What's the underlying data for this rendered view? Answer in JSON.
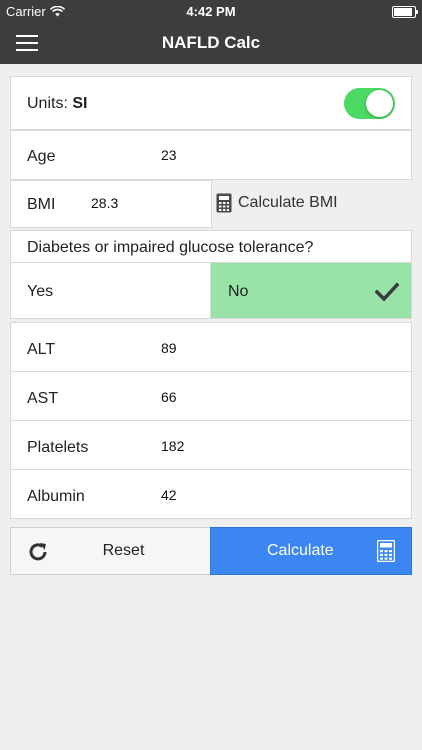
{
  "status_bar": {
    "carrier": "Carrier",
    "time": "4:42 PM"
  },
  "nav": {
    "title": "NAFLD Calc"
  },
  "units": {
    "label": "Units:",
    "value": "SI",
    "toggle_on": true
  },
  "age": {
    "label": "Age",
    "value": "23"
  },
  "bmi": {
    "label": "BMI",
    "value": "28.3",
    "calculate_label": "Calculate BMI"
  },
  "diabetes": {
    "question": "Diabetes or impaired glucose tolerance?",
    "yes_label": "Yes",
    "no_label": "No",
    "selected": "No"
  },
  "labs": [
    {
      "label": "ALT",
      "value": "89"
    },
    {
      "label": "AST",
      "value": "66"
    },
    {
      "label": "Platelets",
      "value": "182"
    },
    {
      "label": "Albumin",
      "value": "42"
    }
  ],
  "actions": {
    "reset_label": "Reset",
    "calculate_label": "Calculate"
  },
  "colors": {
    "navbar": "#3d3d3d",
    "toggle_on": "#4cd964",
    "selected_choice": "#98e3a8",
    "primary_button": "#3b86f0"
  }
}
